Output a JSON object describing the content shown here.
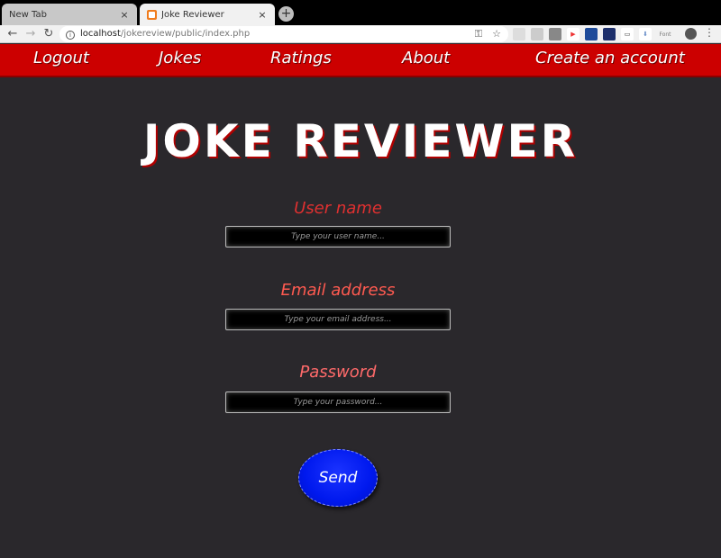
{
  "browser": {
    "tabs": [
      {
        "title": "New Tab",
        "close": "×"
      },
      {
        "title": "Joke Reviewer",
        "close": "×"
      }
    ],
    "new_tab": "+",
    "url_host": "localhost",
    "url_path": "/jokereview/public/index.php",
    "back": "←",
    "forward": "→",
    "reload": "↻",
    "key_icon": "⚿",
    "star_icon": "☆",
    "extension_label": "Font",
    "menu": "⋮"
  },
  "nav": {
    "items": [
      {
        "label": "Logout"
      },
      {
        "label": "Jokes"
      },
      {
        "label": "Ratings"
      },
      {
        "label": "About"
      },
      {
        "label": "Create an account"
      }
    ]
  },
  "page": {
    "title": "JOKE REVIEWER"
  },
  "form": {
    "username_label": "User name",
    "username_placeholder": "Type your user name...",
    "email_label": "Email address",
    "email_placeholder": "Type your email address...",
    "password_label": "Password",
    "password_placeholder": "Type your password...",
    "send_label": "Send"
  },
  "colors": {
    "nav_background": "#cc0000",
    "page_background": "#2a282c",
    "send_button": "#0019ee"
  }
}
